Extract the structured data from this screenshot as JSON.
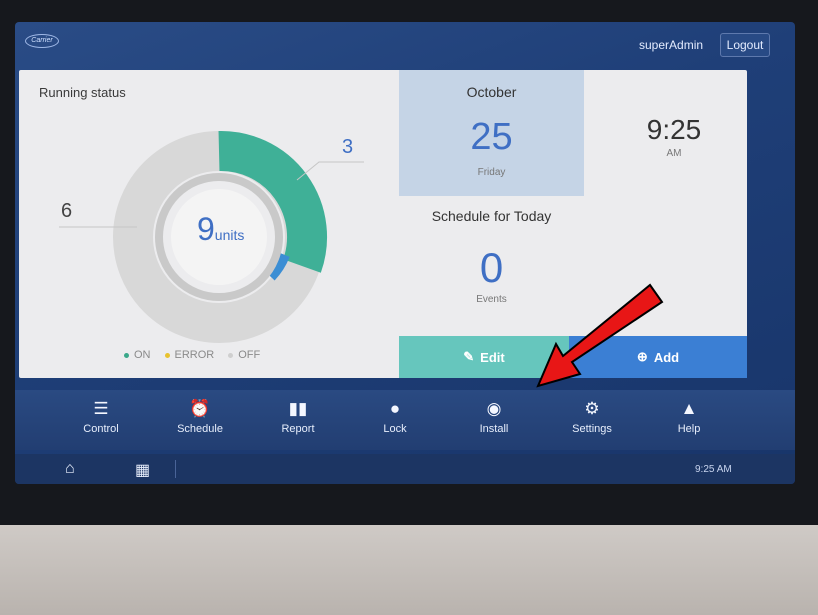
{
  "header": {
    "logo_text": "Carrier",
    "user": "superAdmin",
    "logout_label": "Logout"
  },
  "running_status": {
    "title": "Running status",
    "on_count": "3",
    "off_count": "6",
    "total": "9",
    "total_unit": "units",
    "legend": [
      {
        "label": "ON",
        "color": "#3aa88a"
      },
      {
        "label": "ERROR",
        "color": "#e8c22e"
      },
      {
        "label": "OFF",
        "color": "#cfcfcf"
      }
    ]
  },
  "date": {
    "month": "October",
    "day": "25",
    "weekday": "Friday",
    "time": "9:25",
    "ampm": "AM"
  },
  "schedule": {
    "title": "Schedule for Today",
    "events_count": "0",
    "events_label": "Events",
    "edit_label": "Edit",
    "add_label": "Add"
  },
  "toolbar": {
    "items": [
      {
        "label": "Control",
        "icon": "sliders-icon"
      },
      {
        "label": "Schedule",
        "icon": "alarm-clock-icon"
      },
      {
        "label": "Report",
        "icon": "bar-chart-icon"
      },
      {
        "label": "Lock",
        "icon": "lock-icon"
      },
      {
        "label": "Install",
        "icon": "install-icon"
      },
      {
        "label": "Settings",
        "icon": "gear-icon"
      },
      {
        "label": "Help",
        "icon": "help-icon"
      }
    ]
  },
  "statusbar": {
    "time": "9:25 AM"
  }
}
